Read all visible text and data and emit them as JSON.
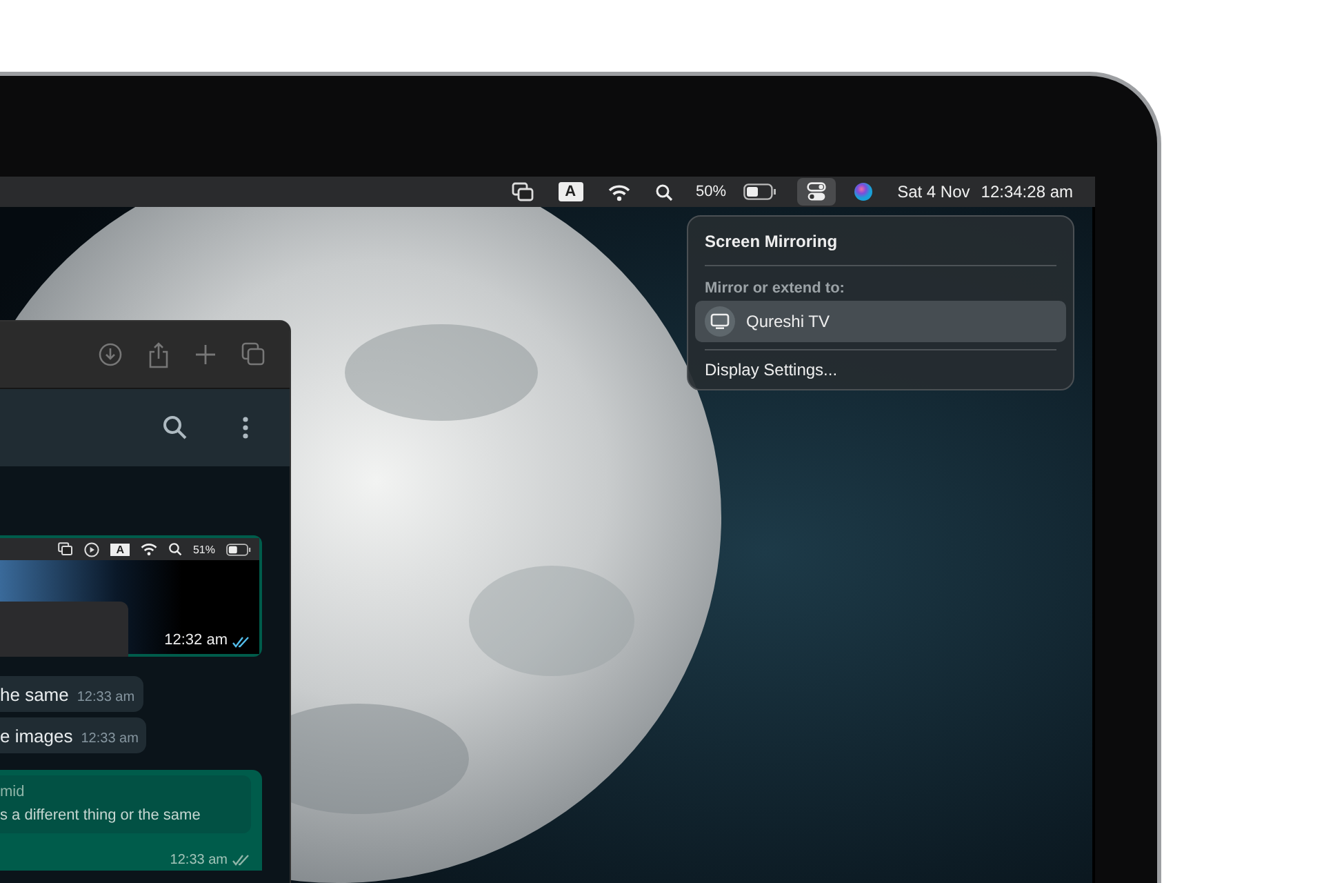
{
  "menu_bar": {
    "input_source": "A",
    "battery_reading": "50%",
    "control_center_active": true,
    "date": "Sat 4 Nov",
    "time": "12:34:28 am"
  },
  "screen_mirroring_menu": {
    "title": "Screen Mirroring",
    "section_label": "Mirror or extend to:",
    "devices": [
      {
        "name": "Qureshi TV",
        "selected": true
      }
    ],
    "footer_item": "Display Settings..."
  },
  "chat": {
    "image_message": {
      "input_source": "A",
      "battery_reading": "51%",
      "time": "12:32 am",
      "read": true
    },
    "messages": [
      {
        "text": "he same",
        "time": "12:33 am"
      },
      {
        "text": "e images",
        "time": "12:33 am"
      }
    ],
    "reply_message": {
      "quoted_author": "mid",
      "quoted_text": "s a different thing or the same",
      "time": "12:33 am",
      "read": false
    }
  }
}
